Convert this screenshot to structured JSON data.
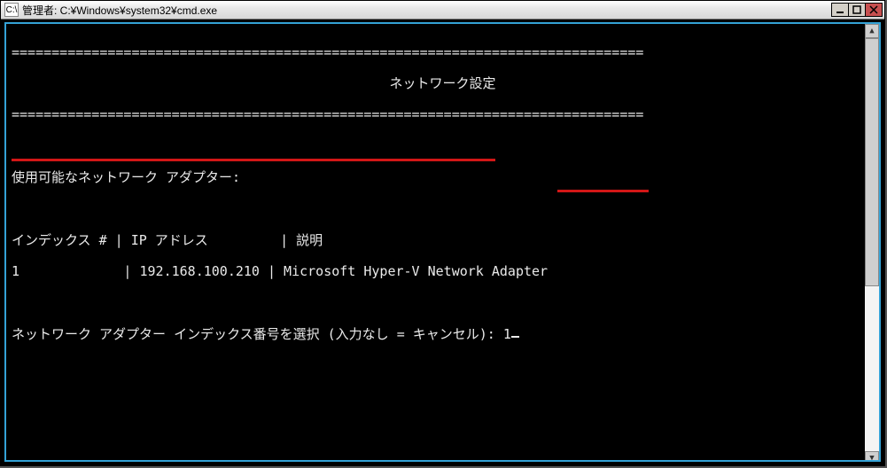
{
  "window": {
    "title": "管理者: C:¥Windows¥system32¥cmd.exe",
    "icon_label": "C:\\"
  },
  "console": {
    "hr": "===============================================================================",
    "header_title": "ネットワーク設定",
    "available_adapters_label": "使用可能なネットワーク アダプター:",
    "table_header": "インデックス # | IP アドレス         | 説明",
    "table_row_1": "1             | 192.168.100.210 | Microsoft Hyper-V Network Adapter",
    "prompt_text": "ネットワーク アダプター インデックス番号を選択 (入力なし = キャンセル): ",
    "prompt_input": "1"
  }
}
